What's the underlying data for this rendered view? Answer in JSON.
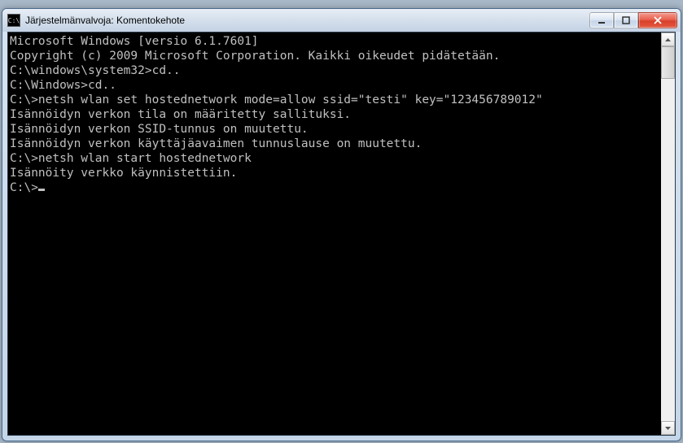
{
  "window": {
    "icon_label": "C:\\",
    "title": "Järjestelmänvalvoja: Komentokehote"
  },
  "terminal": {
    "lines": [
      "Microsoft Windows [versio 6.1.7601]",
      "Copyright (c) 2009 Microsoft Corporation. Kaikki oikeudet pidätetään.",
      "",
      "C:\\windows\\system32>cd..",
      "",
      "C:\\Windows>cd..",
      "",
      "C:\\>netsh wlan set hostednetwork mode=allow ssid=\"testi\" key=\"123456789012\"",
      "Isännöidyn verkon tila on määritetty sallituksi.",
      "Isännöidyn verkon SSID-tunnus on muutettu.",
      "Isännöidyn verkon käyttäjäavaimen tunnuslause on muutettu.",
      "",
      "",
      "C:\\>netsh wlan start hostednetwork",
      "Isännöity verkko käynnistettiin.",
      "",
      "",
      "C:\\>"
    ]
  }
}
